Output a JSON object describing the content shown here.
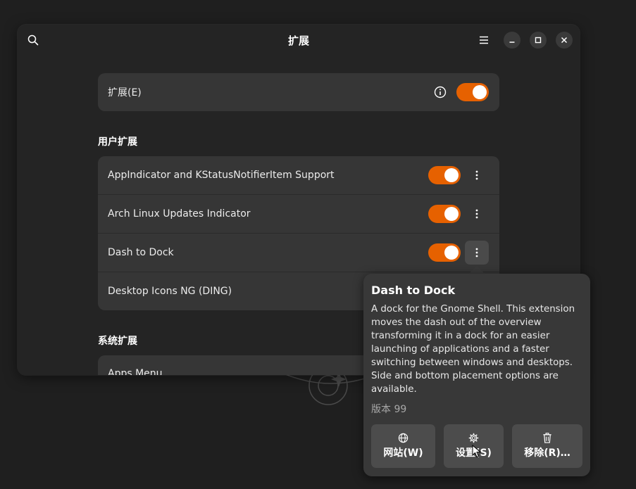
{
  "window": {
    "title": "扩展"
  },
  "extensions_toggle": {
    "label": "扩展(E)",
    "enabled": true,
    "info_icon": "info-icon"
  },
  "user_extensions": {
    "heading": "用户扩展",
    "items": [
      {
        "name": "AppIndicator and KStatusNotifierItem Support",
        "enabled": true
      },
      {
        "name": "Arch Linux Updates Indicator",
        "enabled": true
      },
      {
        "name": "Dash to Dock",
        "enabled": true
      },
      {
        "name": "Desktop Icons NG (DING)",
        "enabled": true
      }
    ]
  },
  "system_extensions": {
    "heading": "系统扩展",
    "items": [
      {
        "name": "Apps Menu"
      }
    ]
  },
  "popover": {
    "title": "Dash to Dock",
    "description": "A dock for the Gnome Shell. This extension moves the dash out of the overview transforming it in a dock for an easier launching of applications and a faster switching between windows and desktops. Side and bottom placement options are available.",
    "version": "版本 99",
    "buttons": {
      "website": "网站(W)",
      "settings": "设置(S)",
      "remove": "移除(R)…"
    }
  },
  "colors": {
    "accent": "#e66100",
    "window_bg": "#242424",
    "card_bg": "#363636",
    "popover_bg": "#383838"
  }
}
